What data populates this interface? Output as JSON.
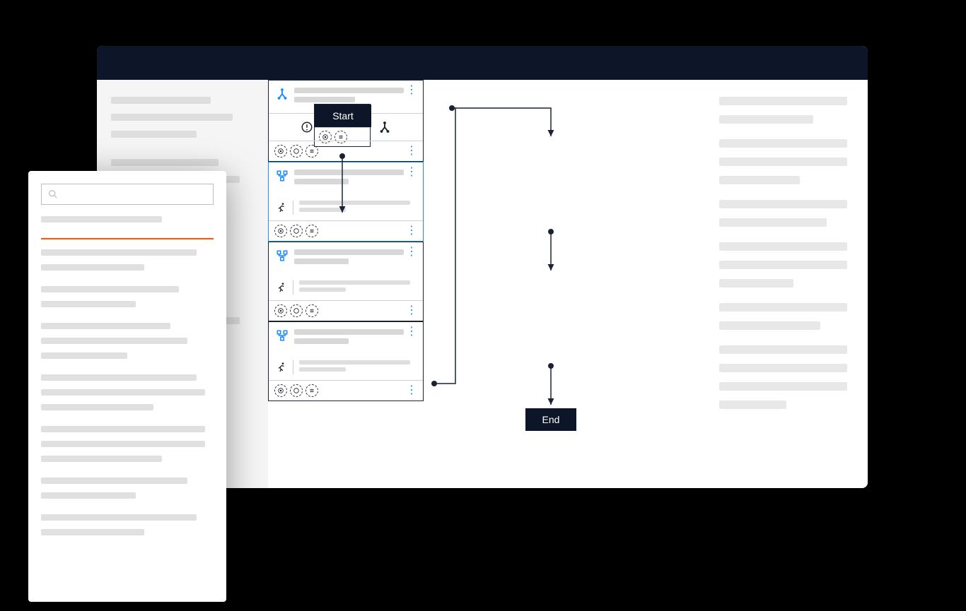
{
  "flow": {
    "start_label": "Start",
    "end_label": "End"
  },
  "icons": {
    "fork": "merge-icon",
    "warning": "warning-icon",
    "hierarchy": "hierarchy-icon",
    "running": "running-person-icon",
    "badge_c": "badge-icon",
    "badge_s": "badge-icon"
  }
}
